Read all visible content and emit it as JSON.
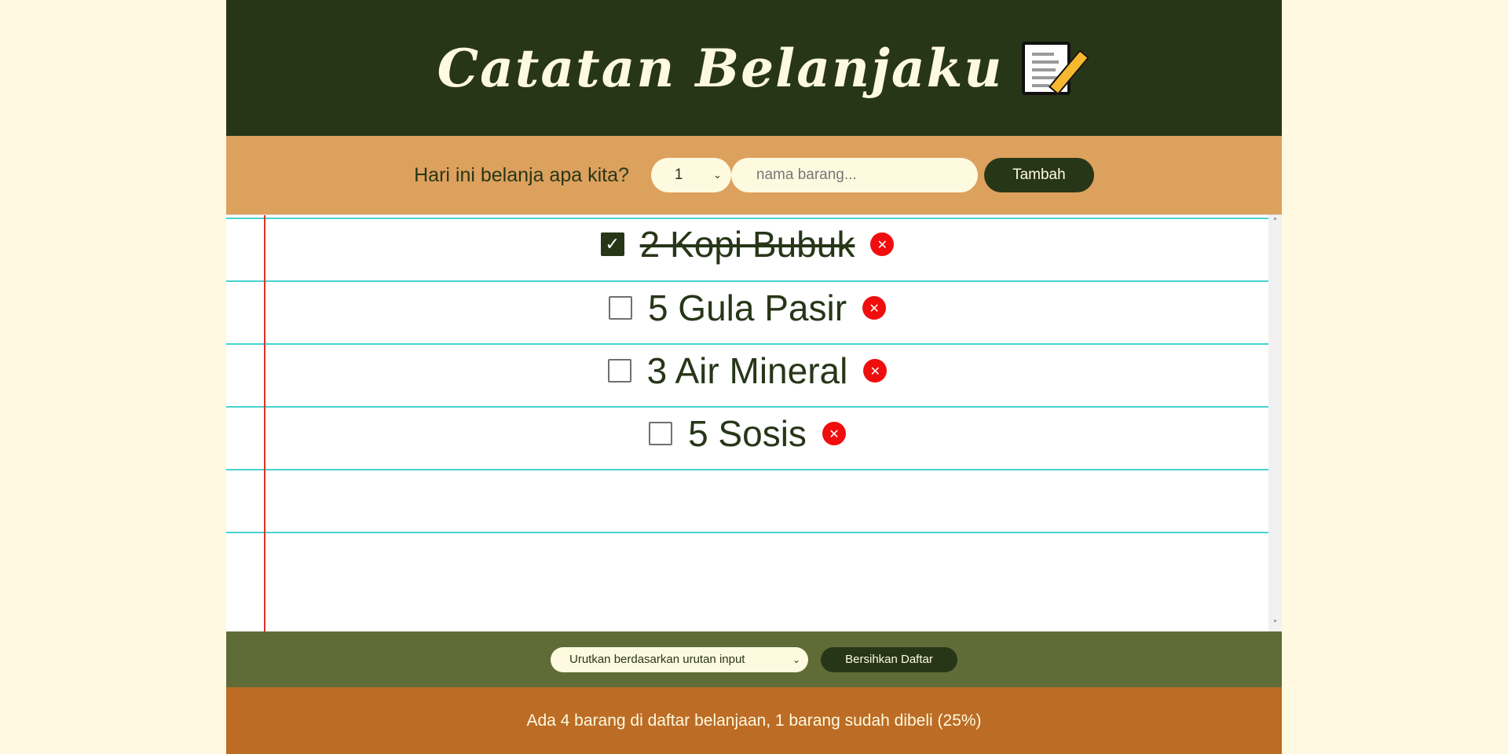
{
  "header": {
    "title": "Catatan Belanjaku",
    "icon": "memo-icon"
  },
  "form": {
    "label": "Hari ini belanja apa kita?",
    "quantity_selected": "1",
    "name_placeholder": "nama barang...",
    "name_value": "",
    "add_label": "Tambah"
  },
  "items": [
    {
      "text": "2 Kopi Bubuk",
      "checked": true
    },
    {
      "text": "5 Gula Pasir",
      "checked": false
    },
    {
      "text": "3 Air Mineral",
      "checked": false
    },
    {
      "text": "5 Sosis",
      "checked": false
    }
  ],
  "actions": {
    "sort_selected": "Urutkan berdasarkan urutan input",
    "clear_label": "Bersihkan Daftar"
  },
  "stats": {
    "text": "Ada 4 barang di daftar belanjaan, 1 barang sudah dibeli (25%)"
  },
  "colors": {
    "header_bg": "#283618",
    "form_bg": "#dda15e",
    "actions_bg": "#606c38",
    "stats_bg": "#bc6c25",
    "page_bg": "#fff9e1",
    "accent_text": "#fefae0",
    "delete_red": "#f00d0d",
    "ruled_line": "#45d4cf",
    "margin_line": "#e0322d"
  }
}
